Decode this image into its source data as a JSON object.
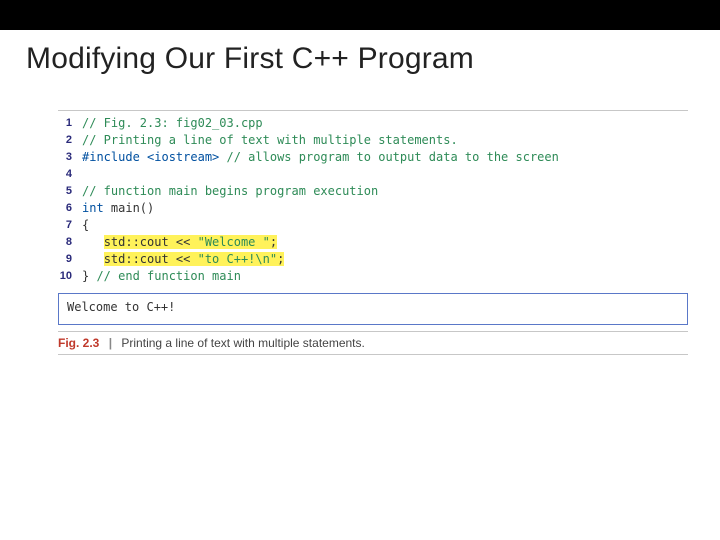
{
  "title": "Modifying Our First C++ Program",
  "code": {
    "lines": [
      {
        "n": "1",
        "segs": [
          {
            "t": "// Fig. 2.3: fig02_03.cpp",
            "c": "cmt"
          }
        ]
      },
      {
        "n": "2",
        "segs": [
          {
            "t": "// Printing a line of text with multiple statements.",
            "c": "cmt"
          }
        ]
      },
      {
        "n": "3",
        "segs": [
          {
            "t": "#include ",
            "c": "kw"
          },
          {
            "t": "<iostream>",
            "c": "hdr"
          },
          {
            "t": " // allows program to output data to the screen",
            "c": "cmt"
          }
        ]
      },
      {
        "n": "4",
        "segs": [
          {
            "t": " ",
            "c": ""
          }
        ]
      },
      {
        "n": "5",
        "segs": [
          {
            "t": "// function main begins program execution",
            "c": "cmt"
          }
        ]
      },
      {
        "n": "6",
        "segs": [
          {
            "t": "int",
            "c": "kw"
          },
          {
            "t": " main()",
            "c": ""
          }
        ]
      },
      {
        "n": "7",
        "segs": [
          {
            "t": "{",
            "c": ""
          }
        ]
      },
      {
        "n": "8",
        "segs": [
          {
            "t": "   ",
            "c": ""
          },
          {
            "t": "std::cout << ",
            "c": "hl"
          },
          {
            "t": "\"Welcome \"",
            "c": "hl str"
          },
          {
            "t": ";",
            "c": "hl"
          }
        ]
      },
      {
        "n": "9",
        "segs": [
          {
            "t": "   ",
            "c": ""
          },
          {
            "t": "std::cout << ",
            "c": "hl"
          },
          {
            "t": "\"to C++!\\n\"",
            "c": "hl str"
          },
          {
            "t": ";",
            "c": "hl"
          }
        ]
      },
      {
        "n": "10",
        "segs": [
          {
            "t": "} ",
            "c": ""
          },
          {
            "t": "// end function main",
            "c": "cmt"
          }
        ]
      }
    ]
  },
  "output": "Welcome to C++!",
  "caption": {
    "label": "Fig. 2.3",
    "text": "Printing a line of text with multiple statements."
  }
}
